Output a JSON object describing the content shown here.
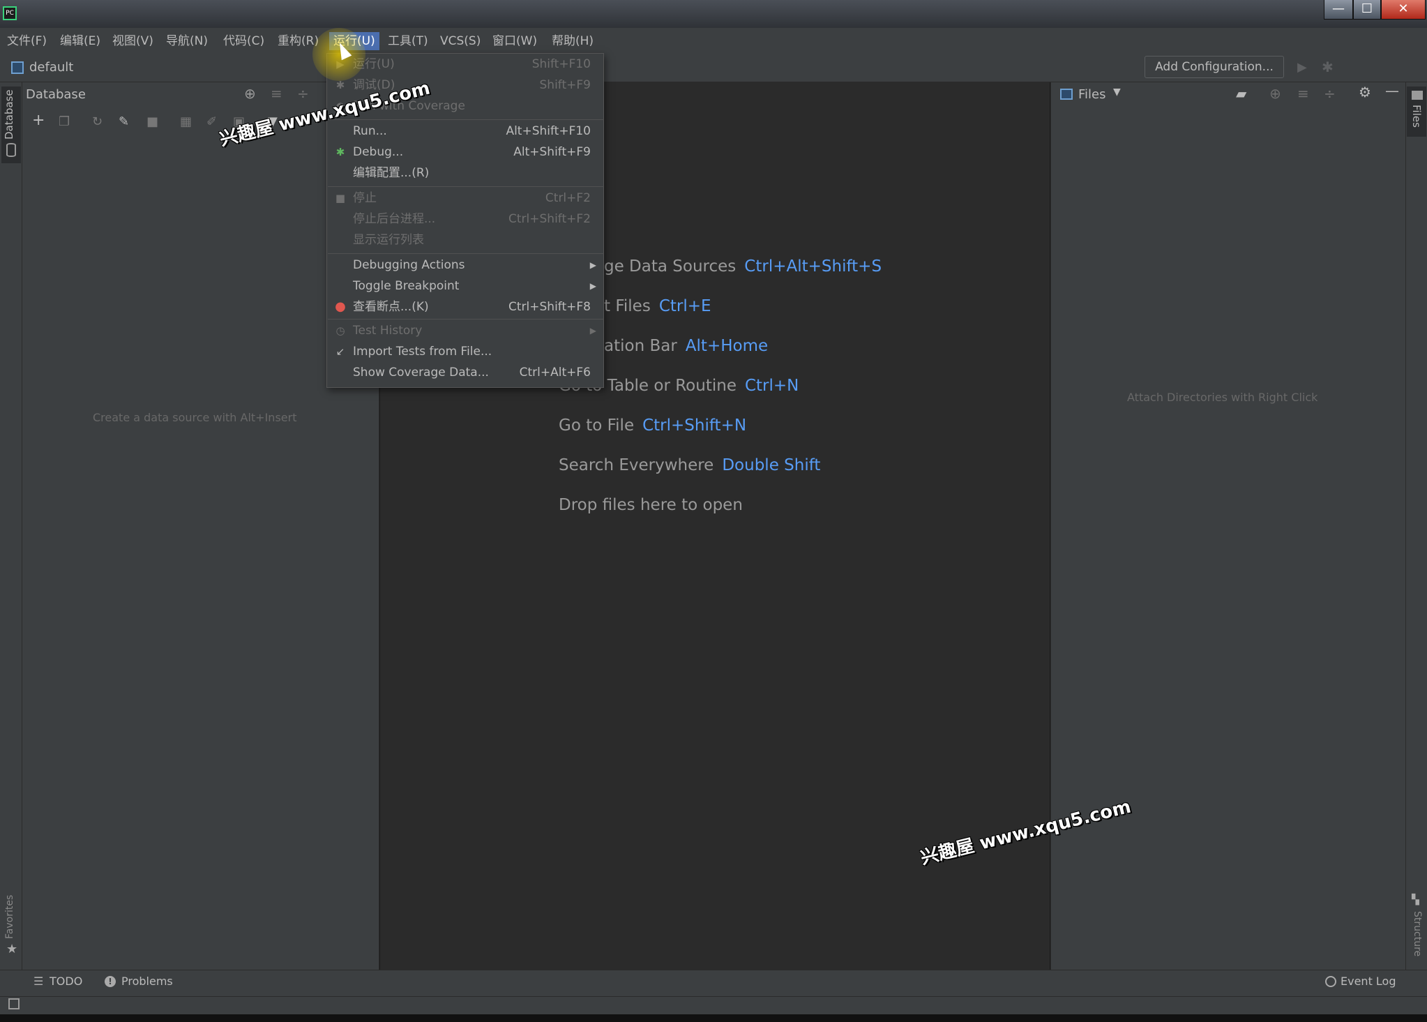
{
  "window": {
    "app_icon": "PC",
    "min": "—",
    "max": "☐",
    "close": "✕"
  },
  "menubar": [
    {
      "label": "文件(F)"
    },
    {
      "label": "编辑(E)"
    },
    {
      "label": "视图(V)"
    },
    {
      "label": "导航(N)"
    },
    {
      "label": "代码(C)"
    },
    {
      "label": "重构(R)"
    },
    {
      "label": "运行(U)"
    },
    {
      "label": "工具(T)"
    },
    {
      "label": "VCS(S)"
    },
    {
      "label": "窗口(W)"
    },
    {
      "label": "帮助(H)"
    }
  ],
  "navbar": {
    "project": "default",
    "add_configuration": "Add Configuration..."
  },
  "database_panel": {
    "title": "Database",
    "empty_text": "Create a data source with Alt+Insert",
    "strip_label": "Database"
  },
  "favorites": {
    "label": "Favorites"
  },
  "run_menu": {
    "items": [
      {
        "label": "运行(U)",
        "shortcut": "Shift+F10",
        "enabled": false
      },
      {
        "label": "调试(D)",
        "shortcut": "Shift+F9",
        "enabled": false
      },
      {
        "label": "Run with Coverage",
        "shortcut": "",
        "enabled": false
      },
      {
        "label": "Run...",
        "shortcut": "Alt+Shift+F10",
        "enabled": true
      },
      {
        "label": "Debug...",
        "shortcut": "Alt+Shift+F9",
        "enabled": true
      },
      {
        "label": "编辑配置...(R)",
        "shortcut": "",
        "enabled": true
      },
      {
        "label": "停止",
        "shortcut": "Ctrl+F2",
        "enabled": false
      },
      {
        "label": "停止后台进程...",
        "shortcut": "Ctrl+Shift+F2",
        "enabled": false
      },
      {
        "label": "显示运行列表",
        "shortcut": "",
        "enabled": false
      },
      {
        "label": "Debugging Actions",
        "shortcut": "",
        "enabled": true
      },
      {
        "label": "Toggle Breakpoint",
        "shortcut": "",
        "enabled": true
      },
      {
        "label": "查看断点...(K)",
        "shortcut": "Ctrl+Shift+F8",
        "enabled": true
      },
      {
        "label": "Test History",
        "shortcut": "",
        "enabled": false
      },
      {
        "label": "Import Tests from File...",
        "shortcut": "",
        "enabled": true
      },
      {
        "label": "Show Coverage Data...",
        "shortcut": "Ctrl+Alt+F6",
        "enabled": true
      }
    ]
  },
  "editor_hints": [
    {
      "text": "ge Data Sources",
      "key": "Ctrl+Alt+Shift+S"
    },
    {
      "text": "t Files",
      "key": "Ctrl+E"
    },
    {
      "text": "ation Bar",
      "key": "Alt+Home"
    },
    {
      "text": "Go to Table or Routine",
      "key": "Ctrl+N"
    },
    {
      "text": "Go to File",
      "key": "Ctrl+Shift+N"
    },
    {
      "text": "Search Everywhere",
      "key": "Double Shift"
    },
    {
      "text": "Drop files here to open",
      "key": ""
    }
  ],
  "files_panel": {
    "title": "Files",
    "empty_text": "Attach Directories with Right Click",
    "strip_label": "Files"
  },
  "structure": {
    "label": "Structure"
  },
  "bottom_tools": {
    "todo": "TODO",
    "problems": "Problems",
    "event_log": "Event Log"
  },
  "watermark": "兴趣屋 www.xqu5.com",
  "colors": {
    "accent": "#4b6eaf",
    "shortcut_blue": "#589df6",
    "panel": "#3c3f41",
    "editor": "#2b2b2b"
  }
}
